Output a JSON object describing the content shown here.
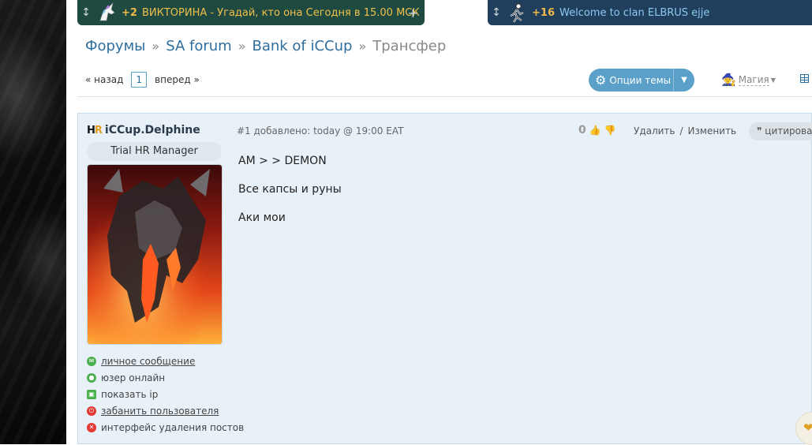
{
  "top_bars": [
    {
      "count": "+2",
      "title": "ВИКТОРИНА - Угадай, кто она Сегодня в 15.00 МСК",
      "add": "+"
    },
    {
      "count": "+16",
      "title": "Welcome to clan ELBRUS ejje"
    }
  ],
  "breadcrumb": {
    "items": [
      "Форумы",
      "SA forum",
      "Bank of iCCup"
    ],
    "current": "Трансфер",
    "sep": "»"
  },
  "pager": {
    "prev": "« назад",
    "page": "1",
    "next": "вперед »"
  },
  "toolbar": {
    "options_label": "Опции темы",
    "magic_label": "Магия"
  },
  "post": {
    "author": "iCCup.Delphine",
    "rank": "Trial HR Manager",
    "meta": "#1 добавлено: today @ 19:00 EAT",
    "votes": "0",
    "delete_label": "Удалить",
    "edit_label": "Изменить",
    "action_sep": "/",
    "quote_label": "цитировать",
    "message": [
      "AM > > DEMON",
      "Все капсы и руны",
      "Аки мои"
    ],
    "links": [
      {
        "label": "личное сообщение",
        "color": "#4caf50",
        "underline": true
      },
      {
        "label": "юзер онлайн",
        "color": "#4caf50",
        "underline": false
      },
      {
        "label": "показать ip",
        "color": "#4caf50",
        "underline": false
      },
      {
        "label": "забанить пользователя",
        "color": "#e53935",
        "underline": true
      },
      {
        "label": "интерфейс удаления постов",
        "color": "#e53935",
        "underline": false
      }
    ]
  }
}
